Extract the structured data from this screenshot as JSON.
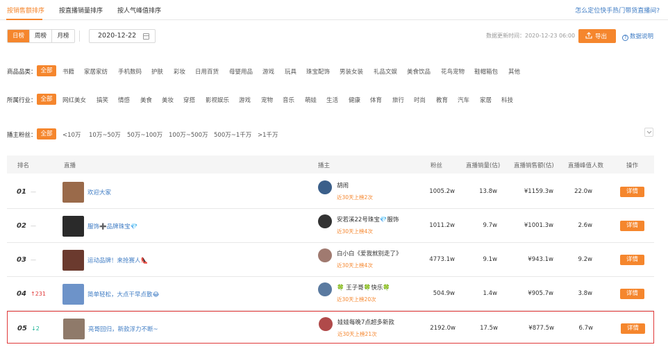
{
  "top_tabs": [
    {
      "label": "按销售额排序",
      "active": true
    },
    {
      "label": "按直播销量排序",
      "active": false
    },
    {
      "label": "按人气峰值排序",
      "active": false
    }
  ],
  "help_link": "怎么定位快手热门带货直播间?",
  "period_tabs": [
    {
      "label": "日榜",
      "active": true
    },
    {
      "label": "周榜",
      "active": false
    },
    {
      "label": "月榜",
      "active": false
    }
  ],
  "date_value": "2020-12-22",
  "update_time": "数据更新时间：2020-12-23 06:00",
  "export_label": "导出",
  "data_desc_label": "数据说明",
  "filters": {
    "category": {
      "label": "商品品类：",
      "options": [
        "全部",
        "书籍",
        "家居家纺",
        "手机数码",
        "护肤",
        "彩妆",
        "日用百货",
        "母婴用品",
        "游戏",
        "玩具",
        "珠宝配饰",
        "男装女装",
        "礼品文娱",
        "美食饮品",
        "花鸟宠物",
        "鞋帽箱包",
        "其他"
      ]
    },
    "industry": {
      "label": "所属行业：",
      "options": [
        "全部",
        "网红美女",
        "搞笑",
        "情感",
        "美食",
        "美妆",
        "穿搭",
        "影视娱乐",
        "游戏",
        "宠物",
        "音乐",
        "萌娃",
        "生活",
        "健康",
        "体育",
        "旅行",
        "时尚",
        "教育",
        "汽车",
        "家居",
        "科技"
      ]
    },
    "fans": {
      "label": "播主粉丝：",
      "options": [
        "全部",
        "<10万",
        "10万~50万",
        "50万~100万",
        "100万~500万",
        "500万~1千万",
        ">1千万"
      ]
    }
  },
  "table": {
    "headers": {
      "rank": "排名",
      "live": "直播",
      "streamer": "播主",
      "fans": "粉丝",
      "sales_volume": "直播销量(估)",
      "sales_amount": "直播销售额(估)",
      "peak_viewers": "直播峰值人数",
      "action": "操作"
    },
    "rows": [
      {
        "rank": "01",
        "trend": "—",
        "trend_type": "dash",
        "title": "欢迎大家",
        "streamer": "胡闹",
        "recent": "近30天上榜2次",
        "fans": "1005.2w",
        "sales_volume": "13.8w",
        "sales_amount": "¥1159.3w",
        "peak_viewers": "22.0w",
        "action": "详情",
        "thumb_color": "#9a6a4a",
        "avatar_color": "#3b5f8a",
        "highlight": false
      },
      {
        "rank": "02",
        "trend": "—",
        "trend_type": "dash",
        "title": "服饰➕品牌珠宝💎",
        "streamer": "安若溪22号珠宝💎服饰",
        "recent": "近30天上榜4次",
        "fans": "1011.2w",
        "sales_volume": "9.7w",
        "sales_amount": "¥1001.3w",
        "peak_viewers": "2.6w",
        "action": "详情",
        "thumb_color": "#2a2a2a",
        "avatar_color": "#333333",
        "highlight": false
      },
      {
        "rank": "03",
        "trend": "—",
        "trend_type": "dash",
        "title": "运动品牌！来抢赛人👠",
        "streamer": "白小白《爱我就别走了》",
        "recent": "近30天上榜4次",
        "fans": "4773.1w",
        "sales_volume": "9.1w",
        "sales_amount": "¥943.1w",
        "peak_viewers": "9.2w",
        "action": "详情",
        "thumb_color": "#6b3a2e",
        "avatar_color": "#a07a70",
        "highlight": false
      },
      {
        "rank": "04",
        "trend": "↑231",
        "trend_type": "up",
        "title": "简单轻松，大点干早点散😂",
        "streamer": "🍀 王子哥🍀快乐🍀",
        "recent": "近30天上榜20次",
        "fans": "504.9w",
        "sales_volume": "1.4w",
        "sales_amount": "¥905.7w",
        "peak_viewers": "3.8w",
        "action": "详情",
        "thumb_color": "#6d93c9",
        "avatar_color": "#5a7aa0",
        "highlight": false
      },
      {
        "rank": "05",
        "trend": "↓2",
        "trend_type": "down",
        "title": "亮哥回归，新款浮力不断~",
        "streamer": "娃娃每晚7点超多新款",
        "recent": "近30天上榜21次",
        "fans": "2192.0w",
        "sales_volume": "17.5w",
        "sales_amount": "¥877.5w",
        "peak_viewers": "6.7w",
        "action": "详情",
        "thumb_color": "#8f7a6a",
        "avatar_color": "#b04a4a",
        "highlight": true
      }
    ]
  },
  "colors": {
    "accent": "#f5862d",
    "link": "#3f7cc4",
    "highlight_border": "#e03838"
  }
}
